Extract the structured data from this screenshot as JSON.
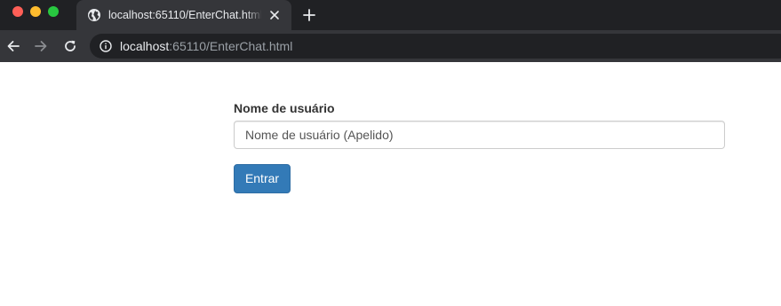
{
  "browser": {
    "tab": {
      "title": "localhost:65110/EnterChat.html",
      "icon": "globe-icon"
    },
    "address_bar": {
      "host": "localhost",
      "path": ":65110/EnterChat.html",
      "icon": "info-icon"
    },
    "controls": {
      "close_tab_icon": "close-icon",
      "new_tab_icon": "plus-icon",
      "back_icon": "arrow-left-icon",
      "forward_icon": "arrow-right-icon",
      "reload_icon": "reload-icon"
    },
    "colors": {
      "traffic_red": "#ff5f57",
      "traffic_yellow": "#febc2e",
      "traffic_green": "#28c840"
    }
  },
  "form": {
    "username_label": "Nome de usuário",
    "username_placeholder": "Nome de usuário (Apelido)",
    "username_value": "",
    "submit_label": "Entrar"
  },
  "colors": {
    "primary_button": "#337ab7",
    "label_text": "#333333"
  }
}
